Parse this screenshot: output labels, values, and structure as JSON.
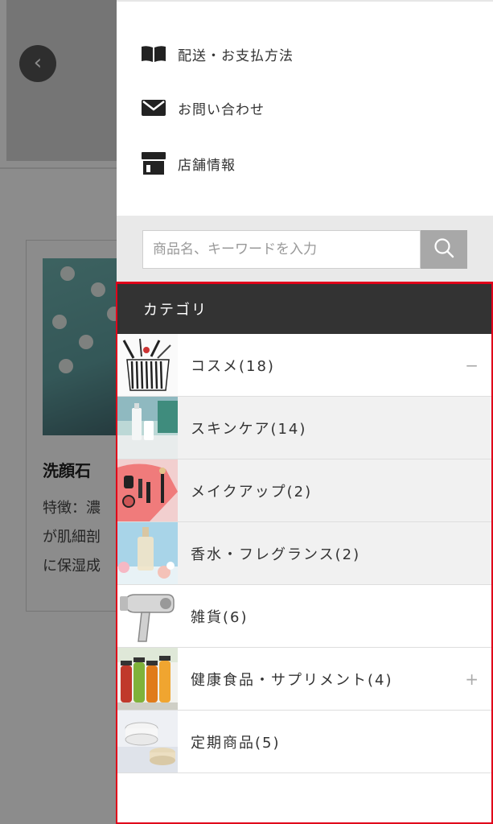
{
  "background_page": {
    "back_icon": "chevron-left-icon",
    "product_title": "洗顔石",
    "description_lines": [
      "特徴：濃",
      "が肌細剖",
      "に保湿成"
    ]
  },
  "drawer": {
    "menu_links": [
      {
        "label": "配送・お支払方法",
        "icon": "book-icon"
      },
      {
        "label": "お問い合わせ",
        "icon": "envelope-icon"
      },
      {
        "label": "店舗情報",
        "icon": "store-icon"
      }
    ],
    "search": {
      "value": "",
      "placeholder": "商品名、キーワードを入力",
      "icon": "search-icon"
    },
    "categories": {
      "header": "カテゴリ",
      "items": [
        {
          "label": "コスメ(18)",
          "toggle": "−",
          "thumbnail": "cosmetics-pouch"
        },
        {
          "label": "スキンケア(14)",
          "toggle": "",
          "thumbnail": "skincare-bottles"
        },
        {
          "label": "メイクアップ(2)",
          "toggle": "",
          "thumbnail": "makeup-items"
        },
        {
          "label": "香水・フレグランス(2)",
          "toggle": "",
          "thumbnail": "perfume-bottle"
        },
        {
          "label": "雑貨(6)",
          "toggle": "",
          "thumbnail": "hair-dryer"
        },
        {
          "label": "健康食品・サプリメント(4)",
          "toggle": "+",
          "thumbnail": "juice-bottles"
        },
        {
          "label": "定期商品(5)",
          "toggle": "",
          "thumbnail": "cream-jar"
        }
      ]
    }
  },
  "colors": {
    "category_header_bg": "#333333",
    "highlight_border": "#e0001a",
    "search_button_bg": "#a8a8a8",
    "overlay": "rgba(0,0,0,0.45)"
  }
}
